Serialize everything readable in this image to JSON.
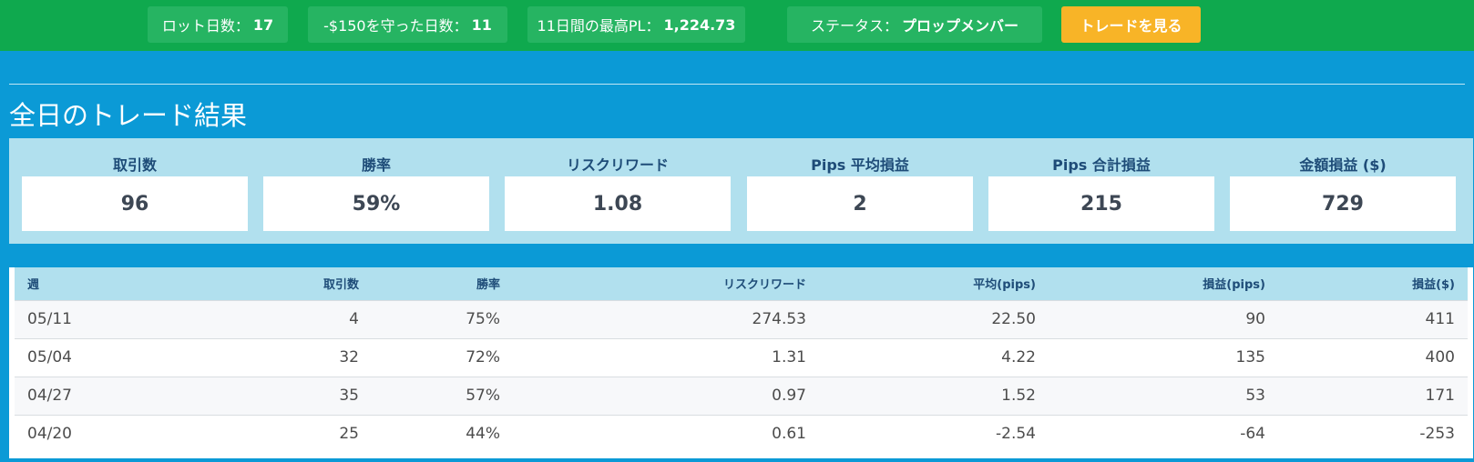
{
  "topbar": {
    "lot_days_label": "ロット日数：",
    "lot_days_value": "17",
    "kept_days_label": "-$150を守った日数：",
    "kept_days_value": "11",
    "best_pl_label": "11日間の最高PL：",
    "best_pl_value": "1,224.73",
    "status_label": "ステータス：",
    "status_value": "プロップメンバー",
    "view_trades_label": "トレードを見る",
    "colors": {
      "bar": "#0fa94e",
      "pill": "#26b462",
      "button": "#f8b427"
    }
  },
  "section": {
    "title": "全日のトレード結果"
  },
  "stats": [
    {
      "label": "取引数",
      "value": "96"
    },
    {
      "label": "勝率",
      "value": "59%"
    },
    {
      "label": "リスクリワード",
      "value": "1.08"
    },
    {
      "label": "Pips 平均損益",
      "value": "2"
    },
    {
      "label": "Pips 合計損益",
      "value": "215"
    },
    {
      "label": "金額損益 ($)",
      "value": "729"
    }
  ],
  "table": {
    "headers": [
      "週",
      "取引数",
      "勝率",
      "リスクリワード",
      "平均(pips)",
      "損益(pips)",
      "損益($)"
    ],
    "rows": [
      [
        "05/11",
        "4",
        "75%",
        "274.53",
        "22.50",
        "90",
        "411"
      ],
      [
        "05/04",
        "32",
        "72%",
        "1.31",
        "4.22",
        "135",
        "400"
      ],
      [
        "04/27",
        "35",
        "57%",
        "0.97",
        "1.52",
        "53",
        "171"
      ],
      [
        "04/20",
        "25",
        "44%",
        "0.61",
        "-2.54",
        "-64",
        "-253"
      ]
    ]
  },
  "colors": {
    "background": "#0b9ad6",
    "panel": "#b1e0ee",
    "header_text": "#1e4c78"
  }
}
